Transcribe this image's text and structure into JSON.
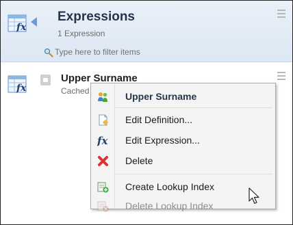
{
  "panel": {
    "title": "Expressions",
    "subtitle": "1 Expression",
    "filter_placeholder": "Type here to filter items"
  },
  "item": {
    "title": "Upper Surname",
    "subtitle_visible": "Cached"
  },
  "context_menu": {
    "items": [
      {
        "label": "Upper Surname",
        "icon": "users-group-icon",
        "style": "bold",
        "enabled": true
      },
      {
        "label": "Edit Definition...",
        "icon": "edit-document-icon",
        "enabled": true
      },
      {
        "label": "Edit Expression...",
        "icon": "fx-icon",
        "enabled": true
      },
      {
        "label": "Delete",
        "icon": "delete-x-icon",
        "enabled": true
      },
      {
        "label": "Create Lookup Index",
        "icon": "create-index-icon",
        "enabled": true
      },
      {
        "label": "Delete Lookup Index",
        "icon": "delete-index-icon",
        "enabled": false
      }
    ]
  },
  "colors": {
    "header_bg": "#e3ecf6",
    "title_text": "#24344c",
    "accent_arrow": "#6a9dd6",
    "delete_red": "#e03030"
  }
}
